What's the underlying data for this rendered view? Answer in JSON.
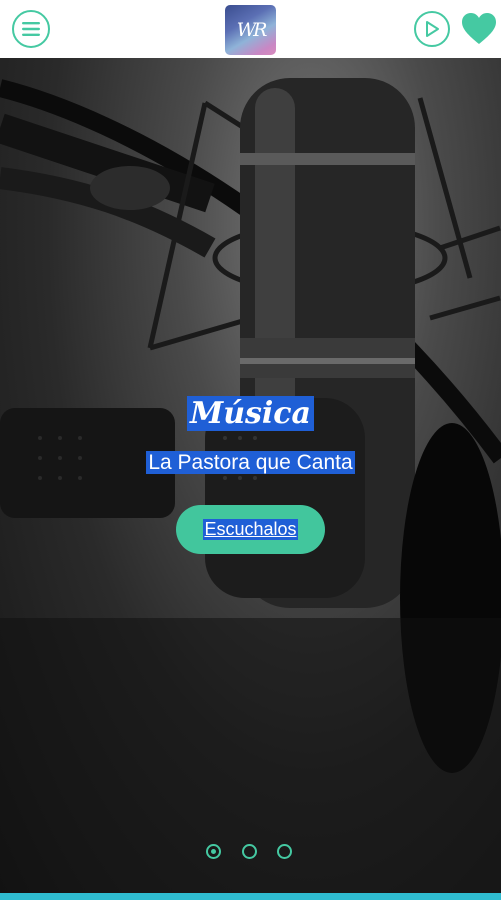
{
  "header": {
    "logo_text": "WR",
    "icons": {
      "menu": "hamburger-menu-icon",
      "play": "play-icon",
      "favorite": "heart-icon"
    },
    "accent_color": "#45c9a2"
  },
  "hero": {
    "title": "Música",
    "subtitle": "La Pastora que Canta",
    "cta_label": "Escuchalos",
    "highlight_color": "#1f5fd6",
    "cta_color": "#42c69d"
  },
  "carousel": {
    "slides": 3,
    "active_index": 0
  }
}
